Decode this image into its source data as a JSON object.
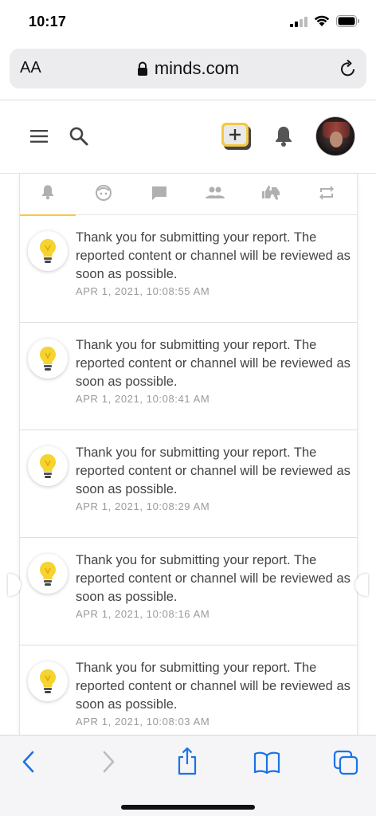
{
  "status": {
    "time": "10:17"
  },
  "browser": {
    "aa_label": "AA",
    "domain": "minds.com"
  },
  "tabs": [
    {
      "name": "tab-all",
      "icon": "bell-icon",
      "active": true
    },
    {
      "name": "tab-tags",
      "icon": "face-icon",
      "active": false
    },
    {
      "name": "tab-comments",
      "icon": "comment-icon",
      "active": false
    },
    {
      "name": "tab-subscriptions",
      "icon": "people-icon",
      "active": false
    },
    {
      "name": "tab-votes",
      "icon": "thumbs-icon",
      "active": false
    },
    {
      "name": "tab-reminds",
      "icon": "repeat-icon",
      "active": false
    }
  ],
  "notifications": [
    {
      "text": "Thank you for submitting your report. The reported content or channel will be reviewed as soon as possible.",
      "time": "APR 1, 2021, 10:08:55 AM"
    },
    {
      "text": "Thank you for submitting your report. The reported content or channel will be reviewed as soon as possible.",
      "time": "APR 1, 2021, 10:08:41 AM"
    },
    {
      "text": "Thank you for submitting your report. The reported content or channel will be reviewed as soon as possible.",
      "time": "APR 1, 2021, 10:08:29 AM"
    },
    {
      "text": "Thank you for submitting your report. The reported content or channel will be reviewed as soon as possible.",
      "time": "APR 1, 2021, 10:08:16 AM"
    },
    {
      "text": "Thank you for submitting your report. The reported content or channel will be reviewed as soon as possible.",
      "time": "APR 1, 2021, 10:08:03 AM"
    }
  ],
  "colors": {
    "accent": "#f5c842",
    "ios_blue": "#1a73e8",
    "icon_gray": "#b0b0b0"
  }
}
